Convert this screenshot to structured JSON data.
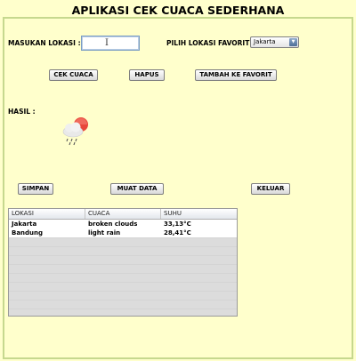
{
  "app": {
    "title": "APLIKASI CEK CUACA SEDERHANA"
  },
  "form": {
    "location_label": "MASUKAN LOKASI :",
    "location_value": "",
    "favorite_label": "PILIH LOKASI FAVORIT :",
    "favorite_selected": "Jakarta"
  },
  "buttons": {
    "check": "CEK CUACA",
    "clear": "HAPUS",
    "add_favorite": "TAMBAH KE FAVORIT",
    "save": "SIMPAN",
    "load": "MUAT DATA",
    "exit": "KELUAR"
  },
  "result": {
    "label": "HASIL :",
    "icon": "rain-sun-icon"
  },
  "table": {
    "columns": [
      "LOKASI",
      "CUACA",
      "SUHU"
    ],
    "rows": [
      [
        "Jakarta",
        "broken clouds",
        "33,13°C"
      ],
      [
        "Bandung",
        "light rain",
        "28,41°C"
      ]
    ]
  },
  "colors": {
    "background": "#ffffcc",
    "panel_border": "#c6d88e",
    "icon_sun": "#e8473b",
    "icon_cloud": "#e6e6e6"
  }
}
